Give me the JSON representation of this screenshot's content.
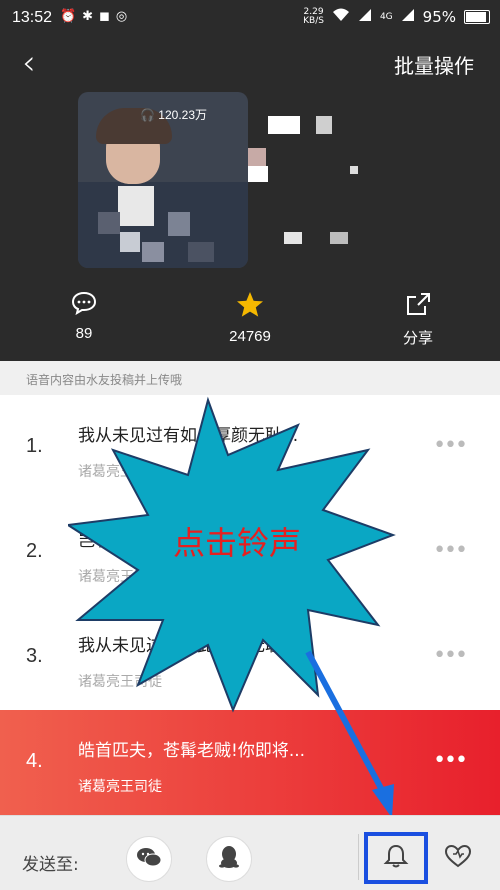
{
  "status_bar": {
    "time": "13:52",
    "net_speed_value": "2.29",
    "net_speed_unit": "KB/S",
    "signal": "4G",
    "battery": "95%"
  },
  "header": {
    "batch_label": "批量操作",
    "plays": "120.23万",
    "comments": "89",
    "favorites": "24769",
    "share_label": "分享"
  },
  "notice": "语音内容由水友投稿并上传哦",
  "tracks": [
    {
      "index": "1.",
      "title": "我从未见过有如此厚颜无耻...",
      "author": "诸葛亮王司徒"
    },
    {
      "index": "2.",
      "title": "岂有此理...",
      "author": "诸葛亮王司徒"
    },
    {
      "index": "3.",
      "title": "我从未见过有如此厚颜无耻...",
      "author": "诸葛亮王司徒"
    },
    {
      "index": "4.",
      "title": "皓首匹夫，苍髯老贼!你即将...",
      "author": "诸葛亮王司徒"
    }
  ],
  "more_icon": "•••",
  "bottom_bar": {
    "send_to": "发送至:"
  },
  "annotation": "点击铃声",
  "colors": {
    "active_row_start": "#f0604e",
    "active_row_end": "#e8202c",
    "starburst": "#0aa7c4",
    "arrow": "#1a6fe0",
    "highlight_box": "#1a4fe0"
  }
}
